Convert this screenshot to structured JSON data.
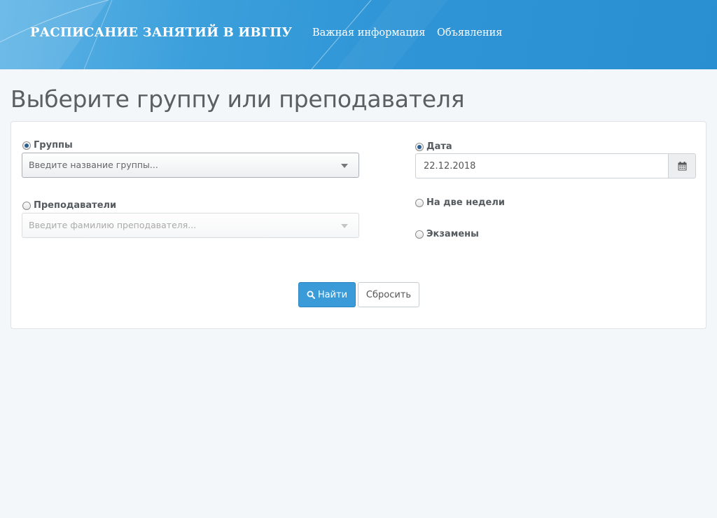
{
  "header": {
    "brand": "РАСПИСАНИЕ ЗАНЯТИЙ В ИВГПУ",
    "nav": [
      {
        "label": "Важная информация"
      },
      {
        "label": "Объявления"
      }
    ],
    "background_color": "#2f95d6"
  },
  "page": {
    "title": "Выберите группу или преподавателя"
  },
  "form": {
    "groups": {
      "label": "Группы",
      "checked": true,
      "placeholder": "Введите название группы..."
    },
    "teachers": {
      "label": "Преподаватели",
      "checked": false,
      "placeholder": "Введите фамилию преподавателя..."
    },
    "date": {
      "label": "Дата",
      "checked": true,
      "value": "22.12.2018",
      "button_icon": "calendar-icon"
    },
    "two_weeks": {
      "label": "На две недели",
      "checked": false
    },
    "exams": {
      "label": "Экзамены",
      "checked": false
    }
  },
  "actions": {
    "search_label": "Найти",
    "search_icon": "search-icon",
    "reset_label": "Сбросить"
  },
  "colors": {
    "primary": "#3a9bd8",
    "page_background": "#f3f7fa",
    "radio_checked": "#2a5e90"
  }
}
